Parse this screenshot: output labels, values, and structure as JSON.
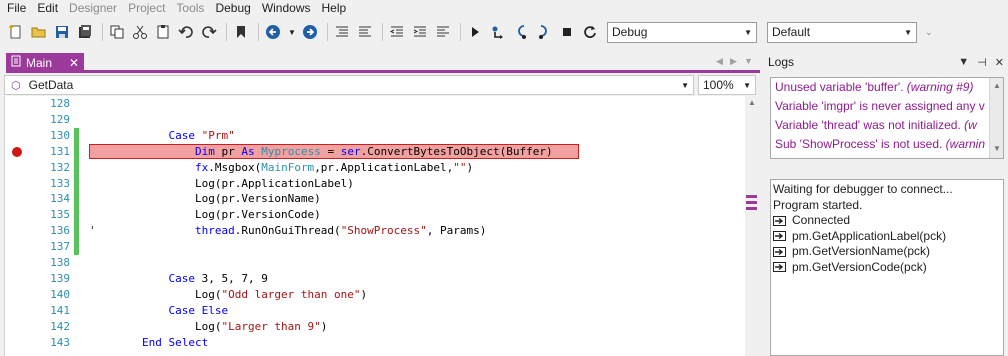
{
  "menu": [
    "File",
    "Edit",
    "Designer",
    "Project",
    "Tools",
    "Debug",
    "Windows",
    "Help"
  ],
  "menu_disabled": [
    "Designer",
    "Project",
    "Tools"
  ],
  "toolbar": {
    "config_combo": "Debug",
    "platform_combo": "Default"
  },
  "document": {
    "tab_label": "Main",
    "member_combo": "GetData",
    "zoom": "100%"
  },
  "code_lines": [
    {
      "n": "128",
      "changed": false,
      "bp": false,
      "marker": "",
      "parts": []
    },
    {
      "n": "129",
      "changed": false,
      "bp": false,
      "marker": "",
      "parts": []
    },
    {
      "n": "130",
      "changed": true,
      "bp": false,
      "marker": "",
      "parts": [
        [
          "",
          "            "
        ],
        [
          "kw",
          "Case "
        ],
        [
          "str",
          "\"Prm\""
        ]
      ]
    },
    {
      "n": "131",
      "changed": true,
      "bp": true,
      "marker": "",
      "parts": [
        [
          "",
          "                "
        ],
        [
          "kw",
          "Dim "
        ],
        [
          "",
          "pr "
        ],
        [
          "kw",
          "As "
        ],
        [
          "typ",
          "Myprocess"
        ],
        [
          "",
          " = "
        ],
        [
          "kw",
          "ser"
        ],
        [
          "",
          ".ConvertBytesToObject(Buffer)"
        ]
      ]
    },
    {
      "n": "132",
      "changed": true,
      "bp": false,
      "marker": "",
      "parts": [
        [
          "",
          "                "
        ],
        [
          "kw",
          "fx"
        ],
        [
          "",
          ".Msgbox("
        ],
        [
          "typ",
          "MainForm"
        ],
        [
          "",
          ",pr.ApplicationLabel,"
        ],
        [
          "str",
          "\"\""
        ],
        [
          "",
          ")"
        ]
      ]
    },
    {
      "n": "133",
      "changed": true,
      "bp": false,
      "marker": "",
      "parts": [
        [
          "",
          "                Log(pr.ApplicationLabel)"
        ]
      ]
    },
    {
      "n": "134",
      "changed": true,
      "bp": false,
      "marker": "",
      "parts": [
        [
          "",
          "                Log(pr.VersionName)"
        ]
      ]
    },
    {
      "n": "135",
      "changed": true,
      "bp": false,
      "marker": "",
      "parts": [
        [
          "",
          "                Log(pr.VersionCode)"
        ]
      ]
    },
    {
      "n": "136",
      "changed": true,
      "bp": false,
      "marker": "'",
      "parts": [
        [
          "",
          "                "
        ],
        [
          "kw",
          "thread"
        ],
        [
          "",
          ".RunOnGuiThread("
        ],
        [
          "str",
          "\"ShowProcess\""
        ],
        [
          "",
          ", Params)"
        ]
      ]
    },
    {
      "n": "137",
      "changed": true,
      "bp": false,
      "marker": "",
      "parts": []
    },
    {
      "n": "138",
      "changed": false,
      "bp": false,
      "marker": "",
      "parts": []
    },
    {
      "n": "139",
      "changed": false,
      "bp": false,
      "marker": "",
      "parts": [
        [
          "",
          "            "
        ],
        [
          "kw",
          "Case "
        ],
        [
          "",
          "3, 5, 7, 9"
        ]
      ]
    },
    {
      "n": "140",
      "changed": false,
      "bp": false,
      "marker": "",
      "parts": [
        [
          "",
          "                Log("
        ],
        [
          "str",
          "\"Odd larger than one\""
        ],
        [
          "",
          ")"
        ]
      ]
    },
    {
      "n": "141",
      "changed": false,
      "bp": false,
      "marker": "",
      "parts": [
        [
          "",
          "            "
        ],
        [
          "kw",
          "Case Else"
        ]
      ]
    },
    {
      "n": "142",
      "changed": false,
      "bp": false,
      "marker": "",
      "parts": [
        [
          "",
          "                Log("
        ],
        [
          "str",
          "\"Larger than 9\""
        ],
        [
          "",
          ")"
        ]
      ]
    },
    {
      "n": "143",
      "changed": false,
      "bp": false,
      "marker": "",
      "parts": [
        [
          "",
          "        "
        ],
        [
          "kw",
          "End Select"
        ]
      ]
    }
  ],
  "logs": {
    "title": "Logs",
    "warnings": [
      {
        "text": "Unused variable 'buffer'. ",
        "note": "(warning #9)"
      },
      {
        "text": "Variable 'imgpr' is never assigned any v",
        "note": ""
      },
      {
        "text": "Variable 'thread' was not initialized. ",
        "note": "(w"
      },
      {
        "text": "Sub 'ShowProcess' is not used. ",
        "note": "(warnin"
      }
    ],
    "output": [
      {
        "icon": false,
        "text": "Waiting for debugger to connect..."
      },
      {
        "icon": false,
        "text": "Program started."
      },
      {
        "icon": true,
        "text": "Connected"
      },
      {
        "icon": true,
        "text": "pm.GetApplicationLabel(pck)"
      },
      {
        "icon": true,
        "text": "pm.GetVersionName(pck)"
      },
      {
        "icon": true,
        "text": "pm.GetVersionCode(pck)"
      }
    ]
  },
  "colors": {
    "accent": "#9b3a9b",
    "breakpoint": "#d01818",
    "breakpoint_line": "#f3a0a0",
    "changed_bar": "#57c25a",
    "line_number": "#2b91af",
    "keyword": "#0000ff",
    "string": "#a31515",
    "warning_text": "#8f1c8f"
  }
}
